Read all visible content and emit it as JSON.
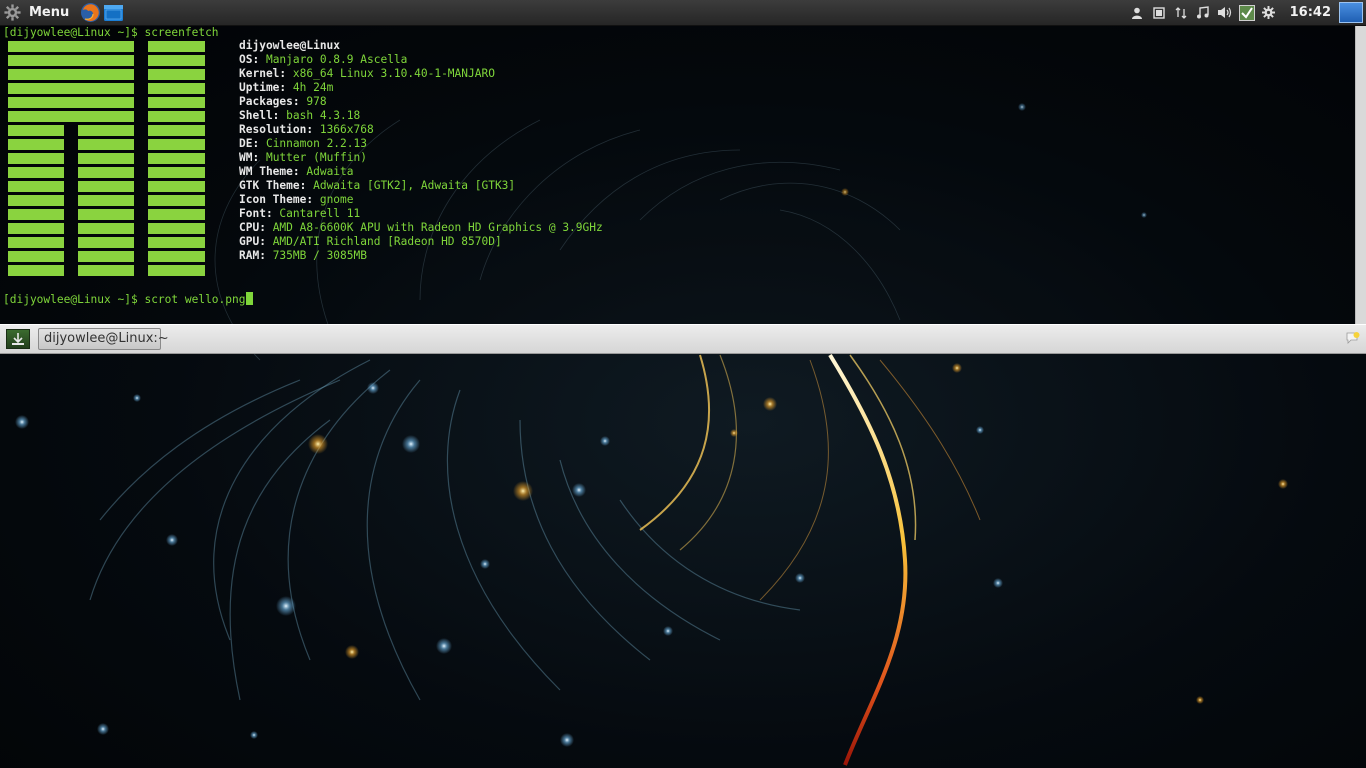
{
  "top_panel": {
    "menu_label": "Menu",
    "menu_icon": "gear-icon",
    "launchers": [
      "firefox-icon",
      "file-manager-icon"
    ],
    "tray_icons": [
      "user-icon",
      "screen-icon",
      "network-icon",
      "music-icon",
      "volume-icon",
      "update-icon",
      "settings-icon"
    ],
    "clock": "16:42"
  },
  "terminal": {
    "prompt_1": "[dijyowlee@Linux ~]$ ",
    "command_1": "screenfetch",
    "host": "dijyowlee@Linux",
    "info": [
      {
        "key": "OS:",
        "value": " Manjaro 0.8.9 Ascella"
      },
      {
        "key": "Kernel:",
        "value": " x86_64 Linux 3.10.40-1-MANJARO"
      },
      {
        "key": "Uptime:",
        "value": " 4h 24m"
      },
      {
        "key": "Packages:",
        "value": " 978"
      },
      {
        "key": "Shell:",
        "value": " bash 4.3.18"
      },
      {
        "key": "Resolution:",
        "value": " 1366x768"
      },
      {
        "key": "DE:",
        "value": " Cinnamon 2.2.13"
      },
      {
        "key": "WM:",
        "value": " Mutter (Muffin)"
      },
      {
        "key": "WM Theme:",
        "value": " Adwaita"
      },
      {
        "key": "GTK Theme:",
        "value": " Adwaita [GTK2], Adwaita [GTK3]"
      },
      {
        "key": "Icon Theme:",
        "value": " gnome"
      },
      {
        "key": "Font:",
        "value": " Cantarell 11"
      },
      {
        "key": "CPU:",
        "value": " AMD A8-6600K APU with Radeon HD Graphics @ 3.9GHz"
      },
      {
        "key": "GPU:",
        "value": " AMD/ATI Richland [Radeon HD 8570D]"
      },
      {
        "key": "RAM:",
        "value": " 735MB / 3085MB"
      }
    ],
    "prompt_2": "[dijyowlee@Linux ~]$ ",
    "command_2": "scrot wello.png",
    "colors": {
      "green": "#7fd63a",
      "logo_green": "#8ad33f",
      "bold": "#e8e8e8"
    }
  },
  "bottom_panel": {
    "show_desktop_icon": "show-desktop-icon",
    "task_label": "dijyowlee@Linux:~",
    "notification_icon": "notification-icon"
  }
}
